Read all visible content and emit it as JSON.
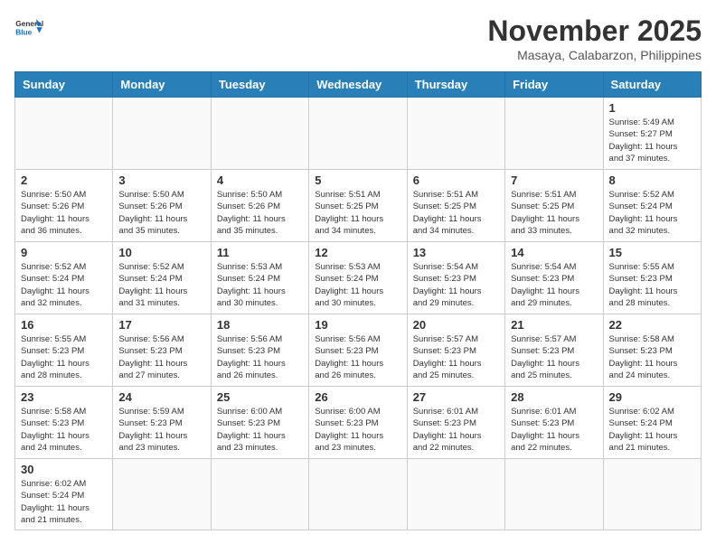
{
  "header": {
    "logo_general": "General",
    "logo_blue": "Blue",
    "month_title": "November 2025",
    "location": "Masaya, Calabarzon, Philippines"
  },
  "days_of_week": [
    "Sunday",
    "Monday",
    "Tuesday",
    "Wednesday",
    "Thursday",
    "Friday",
    "Saturday"
  ],
  "weeks": [
    [
      {
        "day": "",
        "info": ""
      },
      {
        "day": "",
        "info": ""
      },
      {
        "day": "",
        "info": ""
      },
      {
        "day": "",
        "info": ""
      },
      {
        "day": "",
        "info": ""
      },
      {
        "day": "",
        "info": ""
      },
      {
        "day": "1",
        "info": "Sunrise: 5:49 AM\nSunset: 5:27 PM\nDaylight: 11 hours\nand 37 minutes."
      }
    ],
    [
      {
        "day": "2",
        "info": "Sunrise: 5:50 AM\nSunset: 5:26 PM\nDaylight: 11 hours\nand 36 minutes."
      },
      {
        "day": "3",
        "info": "Sunrise: 5:50 AM\nSunset: 5:26 PM\nDaylight: 11 hours\nand 35 minutes."
      },
      {
        "day": "4",
        "info": "Sunrise: 5:50 AM\nSunset: 5:26 PM\nDaylight: 11 hours\nand 35 minutes."
      },
      {
        "day": "5",
        "info": "Sunrise: 5:51 AM\nSunset: 5:25 PM\nDaylight: 11 hours\nand 34 minutes."
      },
      {
        "day": "6",
        "info": "Sunrise: 5:51 AM\nSunset: 5:25 PM\nDaylight: 11 hours\nand 34 minutes."
      },
      {
        "day": "7",
        "info": "Sunrise: 5:51 AM\nSunset: 5:25 PM\nDaylight: 11 hours\nand 33 minutes."
      },
      {
        "day": "8",
        "info": "Sunrise: 5:52 AM\nSunset: 5:24 PM\nDaylight: 11 hours\nand 32 minutes."
      }
    ],
    [
      {
        "day": "9",
        "info": "Sunrise: 5:52 AM\nSunset: 5:24 PM\nDaylight: 11 hours\nand 32 minutes."
      },
      {
        "day": "10",
        "info": "Sunrise: 5:52 AM\nSunset: 5:24 PM\nDaylight: 11 hours\nand 31 minutes."
      },
      {
        "day": "11",
        "info": "Sunrise: 5:53 AM\nSunset: 5:24 PM\nDaylight: 11 hours\nand 30 minutes."
      },
      {
        "day": "12",
        "info": "Sunrise: 5:53 AM\nSunset: 5:24 PM\nDaylight: 11 hours\nand 30 minutes."
      },
      {
        "day": "13",
        "info": "Sunrise: 5:54 AM\nSunset: 5:23 PM\nDaylight: 11 hours\nand 29 minutes."
      },
      {
        "day": "14",
        "info": "Sunrise: 5:54 AM\nSunset: 5:23 PM\nDaylight: 11 hours\nand 29 minutes."
      },
      {
        "day": "15",
        "info": "Sunrise: 5:55 AM\nSunset: 5:23 PM\nDaylight: 11 hours\nand 28 minutes."
      }
    ],
    [
      {
        "day": "16",
        "info": "Sunrise: 5:55 AM\nSunset: 5:23 PM\nDaylight: 11 hours\nand 28 minutes."
      },
      {
        "day": "17",
        "info": "Sunrise: 5:56 AM\nSunset: 5:23 PM\nDaylight: 11 hours\nand 27 minutes."
      },
      {
        "day": "18",
        "info": "Sunrise: 5:56 AM\nSunset: 5:23 PM\nDaylight: 11 hours\nand 26 minutes."
      },
      {
        "day": "19",
        "info": "Sunrise: 5:56 AM\nSunset: 5:23 PM\nDaylight: 11 hours\nand 26 minutes."
      },
      {
        "day": "20",
        "info": "Sunrise: 5:57 AM\nSunset: 5:23 PM\nDaylight: 11 hours\nand 25 minutes."
      },
      {
        "day": "21",
        "info": "Sunrise: 5:57 AM\nSunset: 5:23 PM\nDaylight: 11 hours\nand 25 minutes."
      },
      {
        "day": "22",
        "info": "Sunrise: 5:58 AM\nSunset: 5:23 PM\nDaylight: 11 hours\nand 24 minutes."
      }
    ],
    [
      {
        "day": "23",
        "info": "Sunrise: 5:58 AM\nSunset: 5:23 PM\nDaylight: 11 hours\nand 24 minutes."
      },
      {
        "day": "24",
        "info": "Sunrise: 5:59 AM\nSunset: 5:23 PM\nDaylight: 11 hours\nand 23 minutes."
      },
      {
        "day": "25",
        "info": "Sunrise: 6:00 AM\nSunset: 5:23 PM\nDaylight: 11 hours\nand 23 minutes."
      },
      {
        "day": "26",
        "info": "Sunrise: 6:00 AM\nSunset: 5:23 PM\nDaylight: 11 hours\nand 23 minutes."
      },
      {
        "day": "27",
        "info": "Sunrise: 6:01 AM\nSunset: 5:23 PM\nDaylight: 11 hours\nand 22 minutes."
      },
      {
        "day": "28",
        "info": "Sunrise: 6:01 AM\nSunset: 5:23 PM\nDaylight: 11 hours\nand 22 minutes."
      },
      {
        "day": "29",
        "info": "Sunrise: 6:02 AM\nSunset: 5:24 PM\nDaylight: 11 hours\nand 21 minutes."
      }
    ],
    [
      {
        "day": "30",
        "info": "Sunrise: 6:02 AM\nSunset: 5:24 PM\nDaylight: 11 hours\nand 21 minutes."
      },
      {
        "day": "",
        "info": ""
      },
      {
        "day": "",
        "info": ""
      },
      {
        "day": "",
        "info": ""
      },
      {
        "day": "",
        "info": ""
      },
      {
        "day": "",
        "info": ""
      },
      {
        "day": "",
        "info": ""
      }
    ]
  ]
}
